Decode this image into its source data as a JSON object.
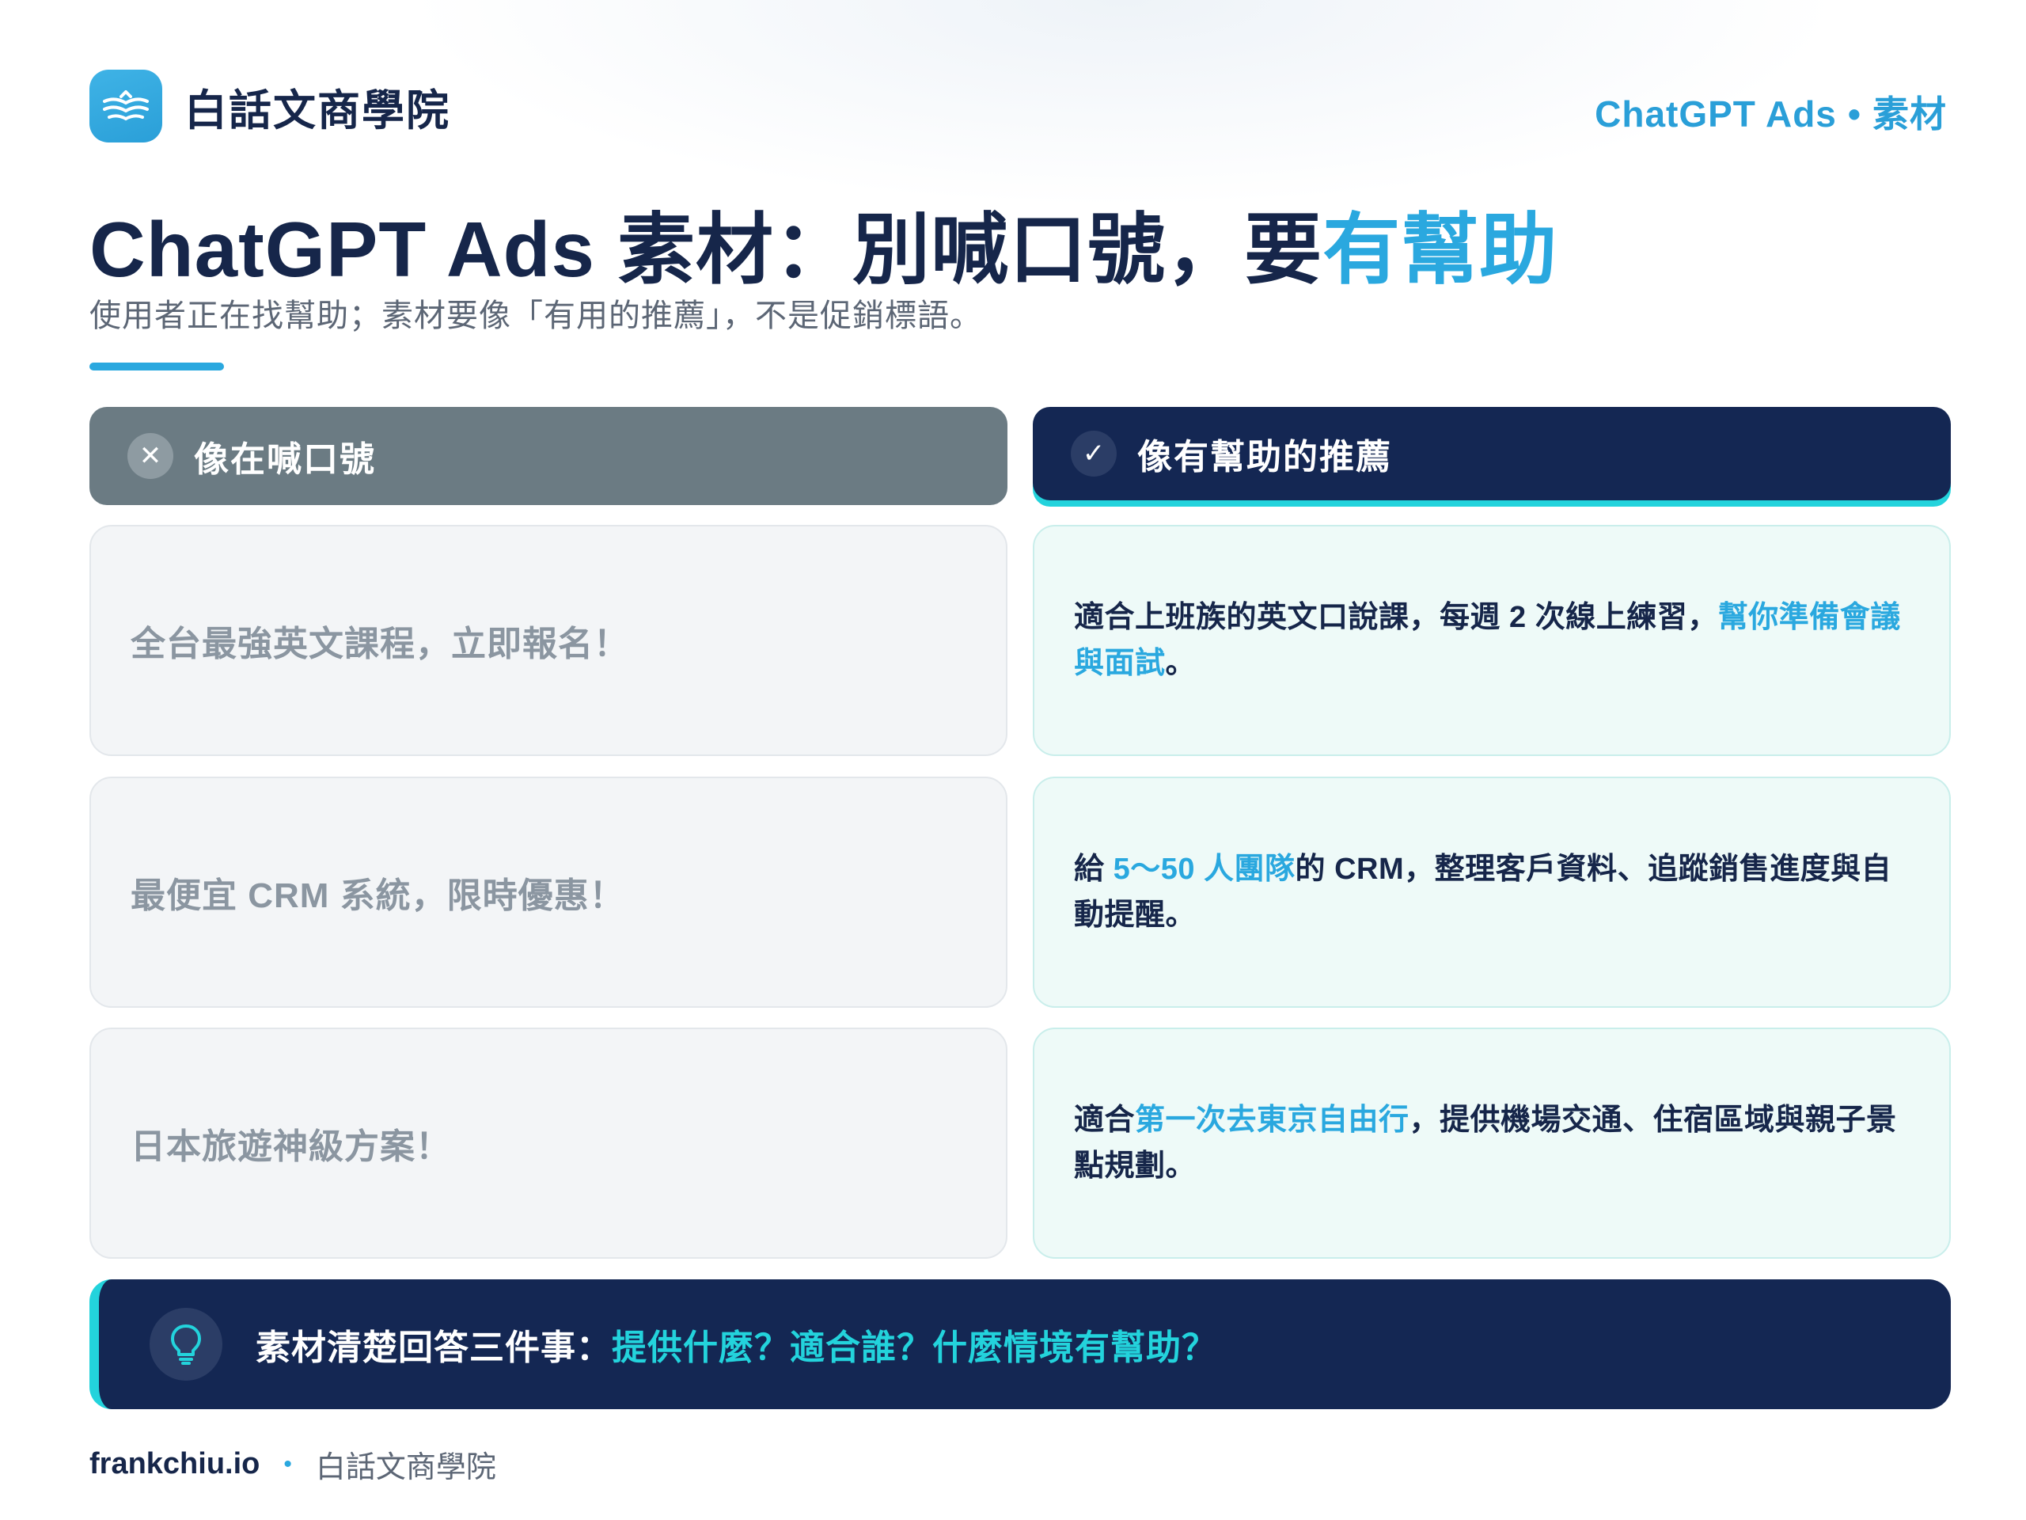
{
  "brand": {
    "name": "白話文商學院",
    "logo_icon": "open-book-icon"
  },
  "top_tag": {
    "left": "ChatGPT Ads",
    "dot": "•",
    "right": "素材"
  },
  "title": {
    "main": "ChatGPT Ads 素材：別喊口號，要",
    "highlight": "有幫助"
  },
  "subtitle": "使用者正在找幫助；素材要像「有用的推薦」，不是促銷標語。",
  "columns": {
    "bad": {
      "icon": "✕",
      "label": "像在喊口號"
    },
    "good": {
      "icon": "✓",
      "label": "像有幫助的推薦"
    }
  },
  "rows": [
    {
      "bad": "全台最強英文課程，立即報名！",
      "good": {
        "pre": "適合上班族的英文口說課，每週 2 次線上練習，",
        "em": "幫你準備會議與面試",
        "post": "。"
      }
    },
    {
      "bad": "最便宜 CRM 系統，限時優惠！",
      "good": {
        "pre": "給 ",
        "em": "5〜50 人團隊",
        "post": "的 CRM，整理客戶資料、追蹤銷售進度與自動提醒。"
      }
    },
    {
      "bad": "日本旅遊神級方案！",
      "good": {
        "pre": "適合",
        "em": "第一次去東京自由行",
        "post": "，提供機場交通、住宿區域與親子景點規劃。"
      }
    }
  ],
  "takeaway": {
    "icon": "lightbulb-icon",
    "lead": "素材清楚回答三件事：",
    "em": "提供什麼？適合誰？什麼情境有幫助？"
  },
  "footer": {
    "site": "frankchiu.io",
    "sep": "•",
    "org": "白話文商學院"
  },
  "colors": {
    "navy": "#16264a",
    "accent_blue": "#2aa8df",
    "teal": "#23d3dc",
    "gray_head": "#6b7b83"
  }
}
